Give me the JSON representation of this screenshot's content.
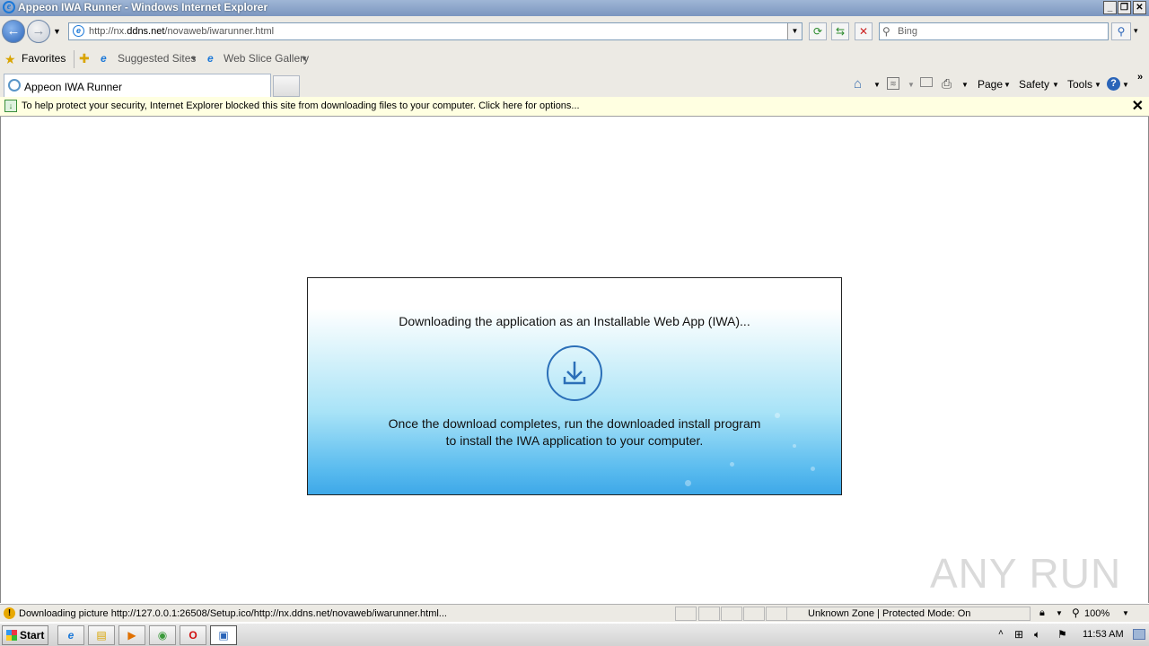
{
  "window": {
    "title": "Appeon IWA Runner - Windows Internet Explorer"
  },
  "address_bar": {
    "url_prefix": "http://nx.",
    "url_domain": "ddns.net",
    "url_path": "/novaweb/iwarunner.html"
  },
  "search": {
    "placeholder": "Bing"
  },
  "favorites_bar": {
    "favorites_label": "Favorites",
    "suggested_sites_label": "Suggested Sites",
    "web_slice_gallery_label": "Web Slice Gallery"
  },
  "tabs": [
    {
      "label": "Appeon IWA Runner"
    }
  ],
  "command_bar": {
    "page_label": "Page",
    "safety_label": "Safety",
    "tools_label": "Tools"
  },
  "info_bar": {
    "message": "To help protect your security, Internet Explorer blocked this site from downloading files to your computer. Click here for options..."
  },
  "page": {
    "heading": "Downloading the application as an Installable Web App (IWA)...",
    "instruction_line1": "Once the download completes, run the downloaded install program",
    "instruction_line2": "to install the IWA application to your computer."
  },
  "watermark": "ANY RUN",
  "status_bar": {
    "message": "Downloading picture http://127.0.0.1:26508/Setup.ico/http://nx.ddns.net/novaweb/iwarunner.html...",
    "zone": "Unknown Zone | Protected Mode: On",
    "zoom": "100%"
  },
  "taskbar": {
    "start_label": "Start",
    "clock": "11:53 AM"
  },
  "colors": {
    "card_gradient_top": "#ffffff",
    "card_gradient_bottom": "#3ea8e8",
    "icon_stroke": "#2b6fb8",
    "info_bar_bg": "#ffffe1"
  }
}
